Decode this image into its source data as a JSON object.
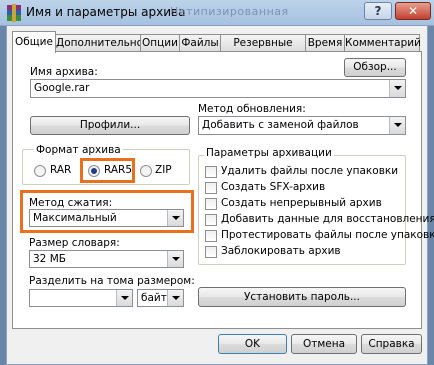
{
  "window": {
    "title": "Имя и параметры архива",
    "ghost_text": "Нетипизированная",
    "help_label": "?",
    "close_label": "✕"
  },
  "tabs": [
    "Общие",
    "Дополнительно",
    "Опции",
    "Файлы",
    "Резервные копии",
    "Время",
    "Комментарий"
  ],
  "archive_name": {
    "label": "Имя архива:",
    "value": "Google.rar",
    "browse_button": "Обзор..."
  },
  "update_method": {
    "label": "Метод обновления:",
    "value": "Добавить с заменой файлов"
  },
  "profiles_button": "Профили...",
  "archive_format": {
    "label": "Формат архива",
    "options": [
      "RAR",
      "RAR5",
      "ZIP"
    ],
    "selected": "RAR5"
  },
  "compression": {
    "label": "Метод сжатия:",
    "value": "Максимальный"
  },
  "dictionary": {
    "label": "Размер словаря:",
    "value": "32 МБ"
  },
  "split": {
    "label": "Разделить на тома размером:",
    "value": "",
    "unit": "байт"
  },
  "archive_options": {
    "label": "Параметры архивации",
    "items": [
      "Удалить файлы после упаковки",
      "Создать SFX-архив",
      "Создать непрерывный архив",
      "Добавить данные для восстановления",
      "Протестировать файлы после упаковки",
      "Заблокировать архив"
    ]
  },
  "set_password_button": "Установить пароль...",
  "buttons": {
    "ok": "OK",
    "cancel": "Отмена",
    "help": "Справка"
  },
  "colors": {
    "highlight": "#e8701e",
    "title_bar": "#bcd3ea"
  }
}
